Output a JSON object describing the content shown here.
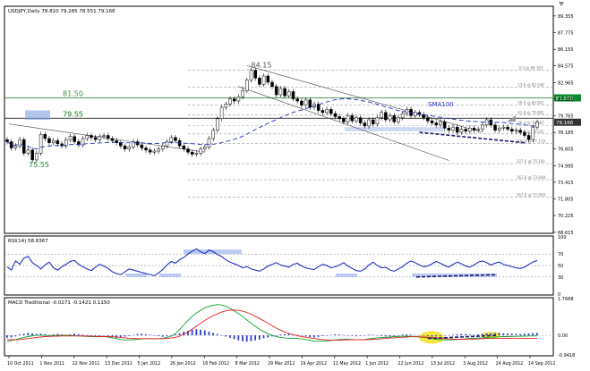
{
  "chart_data": [
    {
      "panel": "price",
      "type": "candlestick",
      "title": "USDJPY,Daily  78.810 79.285 78.551 79.166",
      "yaxis_ticks": [
        "89.355",
        "87.775",
        "86.155",
        "84.575",
        "82.965",
        "81.385",
        "79.765",
        "78.185",
        "76.605",
        "74.995",
        "73.415",
        "71.805",
        "70.225",
        "68.615"
      ],
      "ylim": [
        68.6,
        90.2
      ],
      "xaxis_ticks": [
        "10 Oct 2011",
        "1 Nov 2011",
        "22 Nov 2011",
        "13 Dec 2011",
        "5 Jan 2012",
        "26 Jan 2012",
        "16 Feb 2012",
        "8 Mar 2012",
        "29 Mar 2012",
        "19 Apr 2012",
        "11 May 2012",
        "1 Jun 2012",
        "22 Jun 2012",
        "13 Jul 2012",
        "3 Aug 2012",
        "24 Aug 2012",
        "14 Sep 2012"
      ],
      "close_series": [
        77.3,
        76.7,
        76.9,
        77.5,
        76.2,
        76.5,
        75.55,
        76.2,
        78.0,
        77.6,
        77.2,
        77.4,
        77.1,
        76.9,
        77.5,
        77.8,
        77.3,
        77.0,
        77.6,
        77.9,
        77.7,
        77.5,
        77.8,
        77.9,
        77.6,
        77.4,
        77.2,
        76.9,
        76.6,
        76.8,
        77.3,
        77.0,
        76.7,
        76.5,
        76.3,
        76.4,
        76.6,
        76.9,
        77.3,
        77.7,
        77.4,
        76.9,
        76.6,
        76.3,
        76.1,
        76.2,
        76.6,
        76.8,
        77.6,
        78.4,
        79.5,
        80.6,
        80.9,
        81.4,
        81.2,
        81.6,
        82.2,
        83.2,
        84.15,
        83.4,
        82.8,
        83.6,
        83.0,
        82.6,
        81.8,
        82.4,
        81.7,
        82.1,
        81.4,
        81.2,
        80.8,
        81.3,
        80.6,
        80.9,
        80.3,
        80.1,
        80.4,
        80.0,
        79.7,
        79.5,
        79.2,
        79.8,
        79.3,
        79.6,
        79.1,
        78.8,
        79.4,
        79.0,
        79.6,
        80.1,
        79.4,
        79.8,
        79.2,
        79.6,
        80.0,
        80.4,
        79.8,
        80.1,
        79.9,
        79.6,
        79.3,
        79.1,
        78.9,
        79.2,
        78.6,
        78.4,
        78.7,
        78.2,
        78.5,
        78.3,
        78.6,
        78.4,
        78.5,
        78.9,
        79.4,
        78.9,
        78.4,
        78.6,
        78.7,
        78.5,
        78.3,
        78.4,
        78.2,
        77.9,
        77.5,
        78.7,
        79.166
      ],
      "sma_label": "SMA100",
      "horizontal_levels": [
        {
          "label": "81.50",
          "value": 81.5
        },
        {
          "label": "79.55",
          "value": 79.55
        }
      ],
      "fib_levels": [
        {
          "label": "0.0 @ 84.163",
          "value": 84.163
        },
        {
          "label": "23.6 @ 82.548",
          "value": 82.548
        },
        {
          "label": "50.0 @ 80.801",
          "value": 80.801
        },
        {
          "label": "61.8 @ 79.881",
          "value": 79.881
        },
        {
          "label": "76.4 @ 78.865",
          "value": 78.865
        },
        {
          "label": "88.6 @ 78.045",
          "value": 78.045
        },
        {
          "label": "100.0 @ 77.110",
          "value": 77.11
        },
        {
          "label": "161.8 @ 73.648",
          "value": 73.648
        },
        {
          "label": "127.0 @ 75.191",
          "value": 75.191
        },
        {
          "label": "261.8 @ 72.000",
          "value": 72.0
        }
      ],
      "annotations": [
        "84.15",
        "81.50",
        "79.55",
        "75.55",
        "SMA100"
      ],
      "price_tags": [
        {
          "label": "81.500",
          "value": 81.5,
          "color": "#0a8a2e"
        },
        {
          "label": "79.166",
          "value": 79.166,
          "color": "#333333"
        }
      ]
    },
    {
      "panel": "rsi",
      "type": "line",
      "title": "RSI(14) 58.8367",
      "yaxis_ticks": [
        "100",
        "70",
        "50",
        "30",
        "0"
      ],
      "ylim": [
        0,
        100
      ],
      "values": [
        48,
        42,
        58,
        52,
        63,
        66,
        55,
        50,
        44,
        51,
        56,
        46,
        42,
        48,
        52,
        57,
        59,
        52,
        48,
        44,
        41,
        47,
        52,
        49,
        45,
        39,
        36,
        34,
        39,
        44,
        42,
        40,
        38,
        36,
        34,
        32,
        37,
        43,
        51,
        57,
        54,
        60,
        64,
        70,
        75,
        79,
        74,
        71,
        77,
        74,
        69,
        66,
        60,
        56,
        53,
        50,
        46,
        48,
        44,
        42,
        40,
        44,
        49,
        52,
        55,
        51,
        49,
        47,
        52,
        54,
        49,
        46,
        44,
        43,
        48,
        52,
        50,
        46,
        48,
        51,
        55,
        49,
        45,
        41,
        40,
        44,
        51,
        56,
        50,
        46,
        47,
        42,
        40,
        44,
        48,
        54,
        58,
        55,
        51,
        48,
        49,
        53,
        57,
        54,
        50,
        47,
        52,
        56,
        53,
        49,
        47,
        51,
        56,
        58,
        55,
        51,
        54,
        56,
        52,
        50,
        48,
        46,
        45,
        47,
        52,
        56,
        58.8
      ]
    },
    {
      "panel": "macd",
      "type": "bar",
      "title": "MACD Traditional -0.0271 -0.1421 0.1150",
      "yaxis_ticks": [
        "1.7688",
        "0.00",
        "-0.9418"
      ],
      "ylim": [
        -0.9418,
        1.7688
      ],
      "histogram": [
        -0.12,
        -0.1,
        -0.05,
        0.05,
        0.08,
        0.12,
        0.1,
        0.06,
        0.08,
        0.05,
        0.02,
        0.05,
        0.07,
        0.04,
        0.02,
        0.05,
        0.08,
        0.06,
        0.03,
        0.0,
        -0.03,
        -0.06,
        -0.04,
        -0.02,
        -0.05,
        -0.08,
        -0.12,
        -0.1,
        -0.06,
        -0.03,
        0.02,
        0.06,
        0.08,
        0.05,
        0.03,
        0.0,
        -0.04,
        -0.07,
        -0.05,
        -0.02,
        0.04,
        0.1,
        0.18,
        0.22,
        0.27,
        0.3,
        0.27,
        0.24,
        0.18,
        0.12,
        0.06,
        0.0,
        -0.06,
        -0.12,
        -0.18,
        -0.24,
        -0.28,
        -0.3,
        -0.28,
        -0.24,
        -0.2,
        -0.14,
        -0.1,
        -0.05,
        0.0,
        0.04,
        0.06,
        0.08,
        0.05,
        0.02,
        -0.02,
        -0.05,
        -0.08,
        -0.1,
        -0.07,
        -0.04,
        -0.02,
        0.02,
        0.05,
        0.04,
        0.02,
        0.0,
        -0.03,
        -0.05,
        -0.03,
        0.0,
        0.03,
        0.02,
        -0.01,
        -0.04,
        -0.06,
        -0.05,
        -0.03,
        0.0,
        0.03,
        0.05,
        0.04,
        0.02,
        0.0,
        -0.02,
        -0.04,
        -0.06,
        -0.05,
        -0.03,
        -0.02,
        0.01,
        0.03,
        0.05,
        0.07,
        0.06,
        0.04,
        0.03,
        0.05,
        0.07,
        0.09,
        0.1,
        0.11,
        0.12,
        0.1,
        0.09,
        0.08,
        0.07,
        0.06,
        0.08,
        0.1,
        0.11,
        0.115
      ],
      "macd_line": [
        -0.3,
        -0.25,
        -0.2,
        -0.15,
        -0.1,
        -0.06,
        -0.02,
        0.0,
        0.01,
        0.0,
        -0.02,
        -0.02,
        -0.01,
        0.0,
        0.0,
        -0.01,
        -0.02,
        -0.03,
        -0.04,
        -0.05,
        -0.06,
        -0.07,
        -0.06,
        -0.06,
        -0.08,
        -0.12,
        -0.16,
        -0.2,
        -0.22,
        -0.22,
        -0.21,
        -0.19,
        -0.17,
        -0.16,
        -0.16,
        -0.17,
        -0.16,
        -0.14,
        -0.1,
        -0.04,
        0.08,
        0.28,
        0.5,
        0.72,
        0.92,
        1.08,
        1.2,
        1.32,
        1.4,
        1.45,
        1.48,
        1.46,
        1.4,
        1.3,
        1.18,
        1.05,
        0.9,
        0.74,
        0.58,
        0.44,
        0.3,
        0.18,
        0.08,
        0.0,
        -0.06,
        -0.1,
        -0.13,
        -0.14,
        -0.14,
        -0.15,
        -0.17,
        -0.2,
        -0.24,
        -0.27,
        -0.28,
        -0.28,
        -0.27,
        -0.25,
        -0.22,
        -0.2,
        -0.19,
        -0.19,
        -0.2,
        -0.21,
        -0.21,
        -0.2,
        -0.17,
        -0.14,
        -0.12,
        -0.11,
        -0.1,
        -0.08,
        -0.06,
        -0.05,
        -0.04,
        -0.04,
        -0.05,
        -0.06,
        -0.08,
        -0.1,
        -0.13,
        -0.16,
        -0.19,
        -0.21,
        -0.22,
        -0.22,
        -0.21,
        -0.2,
        -0.18,
        -0.17,
        -0.15,
        -0.14,
        -0.13,
        -0.12,
        -0.1,
        -0.09,
        -0.08,
        -0.07,
        -0.06,
        -0.06,
        -0.05,
        -0.05,
        -0.04,
        -0.04,
        -0.03,
        -0.03,
        -0.0271
      ],
      "signal_line": [
        -0.2,
        -0.21,
        -0.21,
        -0.2,
        -0.18,
        -0.16,
        -0.13,
        -0.1,
        -0.08,
        -0.06,
        -0.05,
        -0.04,
        -0.04,
        -0.03,
        -0.03,
        -0.03,
        -0.03,
        -0.03,
        -0.03,
        -0.04,
        -0.04,
        -0.05,
        -0.05,
        -0.06,
        -0.06,
        -0.07,
        -0.08,
        -0.1,
        -0.12,
        -0.14,
        -0.15,
        -0.16,
        -0.16,
        -0.16,
        -0.16,
        -0.16,
        -0.16,
        -0.16,
        -0.15,
        -0.13,
        -0.1,
        -0.04,
        0.05,
        0.16,
        0.3,
        0.44,
        0.58,
        0.72,
        0.84,
        0.94,
        1.04,
        1.12,
        1.18,
        1.21,
        1.22,
        1.2,
        1.16,
        1.1,
        1.02,
        0.92,
        0.81,
        0.7,
        0.58,
        0.46,
        0.35,
        0.25,
        0.16,
        0.09,
        0.03,
        -0.02,
        -0.06,
        -0.09,
        -0.12,
        -0.15,
        -0.18,
        -0.2,
        -0.22,
        -0.23,
        -0.23,
        -0.23,
        -0.22,
        -0.21,
        -0.21,
        -0.21,
        -0.21,
        -0.21,
        -0.2,
        -0.19,
        -0.18,
        -0.16,
        -0.15,
        -0.13,
        -0.12,
        -0.1,
        -0.09,
        -0.08,
        -0.07,
        -0.07,
        -0.07,
        -0.08,
        -0.09,
        -0.1,
        -0.12,
        -0.14,
        -0.16,
        -0.17,
        -0.18,
        -0.19,
        -0.19,
        -0.19,
        -0.18,
        -0.18,
        -0.17,
        -0.16,
        -0.15,
        -0.15,
        -0.14,
        -0.14,
        -0.14,
        -0.14,
        -0.14,
        -0.14,
        -0.14,
        -0.14,
        -0.14,
        -0.14,
        -0.1421
      ]
    }
  ]
}
